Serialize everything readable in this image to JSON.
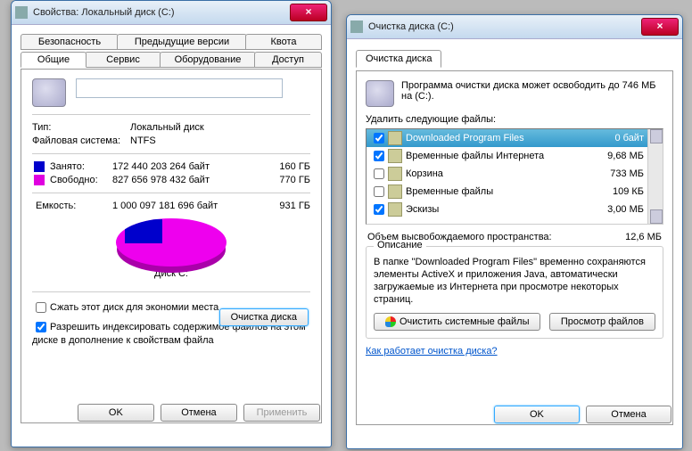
{
  "win1": {
    "title": "Свойства: Локальный диск (C:)",
    "tabs_r1": [
      "Безопасность",
      "Предыдущие версии",
      "Квота"
    ],
    "tabs_r2": [
      "Общие",
      "Сервис",
      "Оборудование",
      "Доступ"
    ],
    "active_tab": "Общие",
    "type_label": "Тип:",
    "type_value": "Локальный диск",
    "fs_label": "Файловая система:",
    "fs_value": "NTFS",
    "used_label": "Занято:",
    "used_bytes": "172 440 203 264 байт",
    "used_gb": "160 ГБ",
    "used_color": "#0000cc",
    "free_label": "Свободно:",
    "free_bytes": "827 656 978 432 байт",
    "free_gb": "770 ГБ",
    "free_color": "#e000e0",
    "cap_label": "Емкость:",
    "cap_bytes": "1 000 097 181 696 байт",
    "cap_gb": "931 ГБ",
    "pie_label": "Диск C:",
    "cleanup_btn": "Очистка диска",
    "compress": "Сжать этот диск для экономии места",
    "index": "Разрешить индексировать содержимое файлов на этом диске в дополнение к свойствам файла",
    "ok": "OK",
    "cancel": "Отмена",
    "apply": "Применить"
  },
  "win2": {
    "title": "Очистка диска  (C:)",
    "tab": "Очистка диска",
    "intro": "Программа очистки диска может освободить до 746 МБ на  (C:).",
    "del_label": "Удалить следующие файлы:",
    "items": [
      {
        "chk": true,
        "name": "Downloaded Program Files",
        "size": "0 байт",
        "sel": true
      },
      {
        "chk": true,
        "name": "Временные файлы Интернета",
        "size": "9,68 МБ"
      },
      {
        "chk": false,
        "name": "Корзина",
        "size": "733 МБ"
      },
      {
        "chk": false,
        "name": "Временные файлы",
        "size": "109 КБ"
      },
      {
        "chk": true,
        "name": "Эскизы",
        "size": "3,00 МБ"
      }
    ],
    "freed_label": "Объем высвобождаемого пространства:",
    "freed_value": "12,6 МБ",
    "desc_title": "Описание",
    "desc_text": "В папке \"Downloaded Program Files\" временно сохраняются элементы ActiveX и приложения Java, автоматически загружаемые из Интернета при просмотре некоторых страниц.",
    "clean_sys": "Очистить системные файлы",
    "view_files": "Просмотр файлов",
    "how_link": "Как работает очистка диска?",
    "ok": "OK",
    "cancel": "Отмена"
  },
  "chart_data": {
    "type": "pie",
    "title": "Диск C:",
    "series": [
      {
        "name": "Занято",
        "value": 160,
        "unit": "ГБ",
        "bytes": 172440203264,
        "color": "#0000cc"
      },
      {
        "name": "Свободно",
        "value": 770,
        "unit": "ГБ",
        "bytes": 827656978432,
        "color": "#e000e0"
      }
    ],
    "total": {
      "value": 931,
      "unit": "ГБ",
      "bytes": 1000097181696
    }
  }
}
